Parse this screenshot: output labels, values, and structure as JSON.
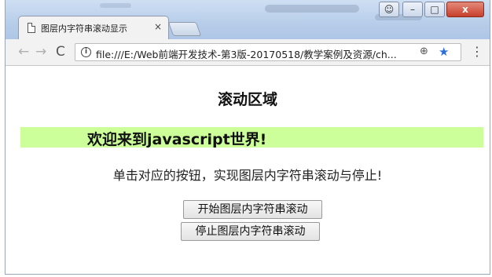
{
  "browser": {
    "tab_title": "图层内字符串滚动显示",
    "tab_close": "×",
    "url": "file:///E:/Web前端开发技术-第3版-20170518/教学案例及资源/ch...",
    "window_controls": {
      "user": "☺",
      "minimize": "–",
      "maximize": "□",
      "close": "x"
    },
    "nav": {
      "back": "←",
      "forward": "→",
      "reload": "C"
    },
    "icons": {
      "info": "i",
      "zoom": "⊕",
      "star": "★",
      "menu": "⋮"
    }
  },
  "page": {
    "heading": "滚动区域",
    "marquee_text": "欢迎来到javascript世界!",
    "marquee_bg": "#ccff99",
    "description": "单击对应的按钮，实现图层内字符串滚动与停止!",
    "start_button": "开始图层内字符串滚动",
    "stop_button": "停止图层内字符串滚动"
  }
}
